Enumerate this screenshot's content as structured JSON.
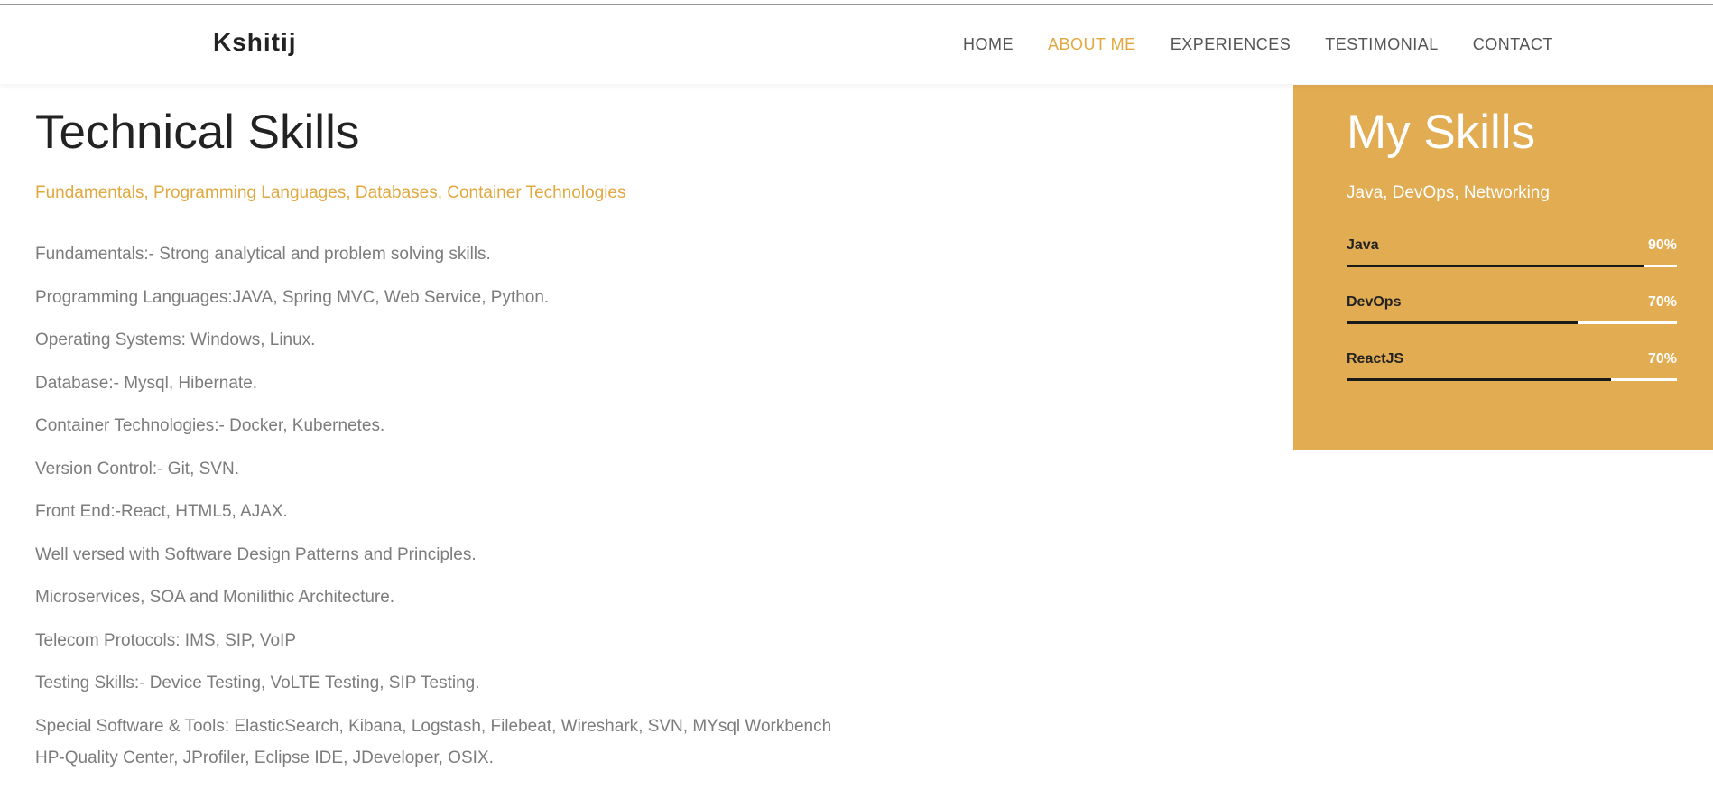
{
  "brand": "Kshitij",
  "nav": [
    {
      "label": "HOME",
      "active": false
    },
    {
      "label": "ABOUT ME",
      "active": true
    },
    {
      "label": "EXPERIENCES",
      "active": false
    },
    {
      "label": "TESTIMONIAL",
      "active": false
    },
    {
      "label": "CONTACT",
      "active": false
    }
  ],
  "main": {
    "title": "Technical Skills",
    "subtitle": "Fundamentals, Programming Languages, Databases, Container Technologies",
    "items": [
      "Fundamentals:- Strong analytical and problem solving skills.",
      "Programming Languages:JAVA, Spring MVC, Web Service, Python.",
      "Operating Systems: Windows, Linux.",
      "Database:- Mysql, Hibernate.",
      "Container Technologies:- Docker, Kubernetes.",
      "Version Control:- Git, SVN.",
      "Front End:-React, HTML5, AJAX.",
      "Well versed with Software Design Patterns and Principles.",
      "Microservices, SOA and Monilithic Architecture.",
      "Telecom Protocols: IMS, SIP, VoIP",
      "Testing Skills:- Device Testing, VoLTE Testing, SIP Testing.",
      "Special Software & Tools: ElasticSearch, Kibana, Logstash, Filebeat, Wireshark, SVN, MYsql Workbench",
      "HP-Quality Center, JProfiler, Eclipse IDE, JDeveloper, OSIX."
    ]
  },
  "skills_panel": {
    "title": "My Skills",
    "subtitle": "Java, DevOps, Networking",
    "bars": [
      {
        "name": "Java",
        "percent_label": "90%",
        "fill_fraction": 0.9
      },
      {
        "name": "DevOps",
        "percent_label": "70%",
        "fill_fraction": 0.7
      },
      {
        "name": "ReactJS",
        "percent_label": "70%",
        "fill_fraction": 0.8
      }
    ]
  },
  "colors": {
    "accent": "#e2a83f",
    "panel_bg": "#e2ac53",
    "text_muted": "#7c7c7c"
  }
}
